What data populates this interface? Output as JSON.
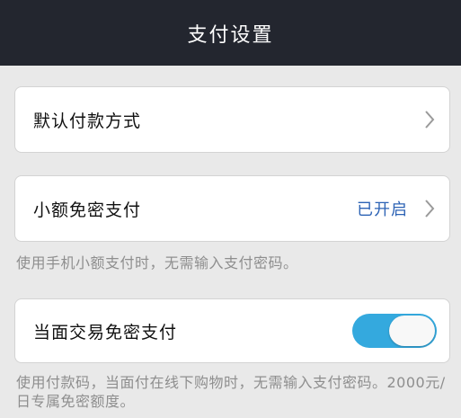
{
  "header": {
    "title": "支付设置"
  },
  "rows": {
    "default_payment": {
      "label": "默认付款方式"
    },
    "small_pay": {
      "label": "小额免密支付",
      "status": "已开启",
      "hint": "使用手机小额支付时，无需输入支付密码。"
    },
    "f2f_pay": {
      "label": "当面交易免密支付",
      "enabled": true,
      "hint": "使用付款码，当面付在线下购物时，无需输入支付密码。2000元/日专属免密额度。"
    }
  },
  "colors": {
    "header_bg": "#23262f",
    "accent": "#34a9de",
    "status_text": "#2d63b5"
  },
  "icons": {
    "chevron": "chevron-right-icon"
  }
}
